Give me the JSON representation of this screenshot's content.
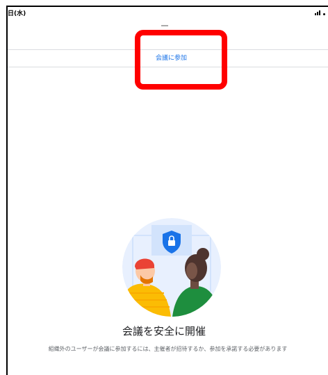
{
  "status_bar": {
    "time": "日(水)",
    "icons": [
      "signal-icon",
      "battery-icon"
    ]
  },
  "toolbar": {
    "join_meeting_label": "会議に参加"
  },
  "empty_state": {
    "illustration": "safe-meeting-illustration",
    "title": "会議を安全に開催",
    "description": "組織外のユーザーが会議に参加するには、主催者が招待するか、参加を承諾する必要があります"
  },
  "colors": {
    "accent": "#1a73e8",
    "highlight": "#ff0000",
    "shield": "#1a73e8",
    "illustration_bg": "#e8f0fe"
  }
}
